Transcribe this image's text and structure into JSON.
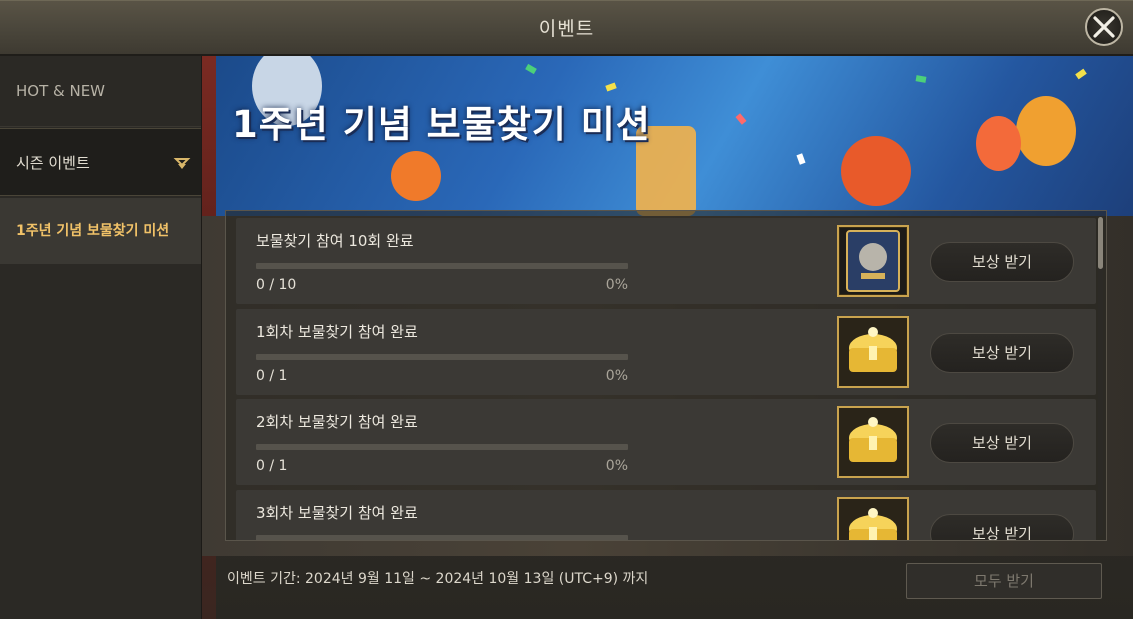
{
  "window": {
    "title": "이벤트"
  },
  "sidebar": {
    "items": [
      {
        "label": "HOT & NEW"
      },
      {
        "label": "시즌 이벤트"
      },
      {
        "label": "1주년 기념 보물찾기 미션"
      }
    ]
  },
  "banner": {
    "title": "1주년 기념 보물찾기 미션"
  },
  "missions": [
    {
      "title": "보물찾기 참여 10회 완료",
      "count": "0 / 10",
      "percent": "0%",
      "progress": 0,
      "reward_icon": "card-icon",
      "button": "보상 받기"
    },
    {
      "title": "1회차 보물찾기 참여 완료",
      "count": "0 / 1",
      "percent": "0%",
      "progress": 0,
      "reward_icon": "treasure-chest-icon",
      "button": "보상 받기"
    },
    {
      "title": "2회차 보물찾기 참여 완료",
      "count": "0 / 1",
      "percent": "0%",
      "progress": 0,
      "reward_icon": "treasure-chest-icon",
      "button": "보상 받기"
    },
    {
      "title": "3회차 보물찾기 참여 완료",
      "count": "",
      "percent": "",
      "progress": 0,
      "reward_icon": "treasure-chest-icon",
      "button": "보상 받기"
    }
  ],
  "footer": {
    "period": "이벤트 기간: 2024년 9월 11일 ~ 2024년 10월 13일 (UTC+9) 까지",
    "claim_all": "모두 받기"
  },
  "colors": {
    "accent_gold": "#f1c268",
    "progress_fill": "#e0b85a"
  }
}
